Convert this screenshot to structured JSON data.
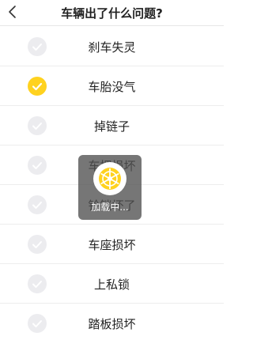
{
  "header": {
    "title": "车辆出了什么问题?"
  },
  "issues": [
    {
      "label": "刹车失灵",
      "selected": false
    },
    {
      "label": "车胎没气",
      "selected": true
    },
    {
      "label": "掉链子",
      "selected": false
    },
    {
      "label": "车把损坏",
      "selected": false
    },
    {
      "label": "铃铛坏了",
      "selected": false
    },
    {
      "label": "车座损坏",
      "selected": false
    },
    {
      "label": "上私锁",
      "selected": false
    },
    {
      "label": "踏板损坏",
      "selected": false
    }
  ],
  "loading": {
    "text": "加载中...",
    "icon": "bike-wheel-icon"
  },
  "colors": {
    "accent": "#ffd21f",
    "unchecked": "#ececef"
  }
}
